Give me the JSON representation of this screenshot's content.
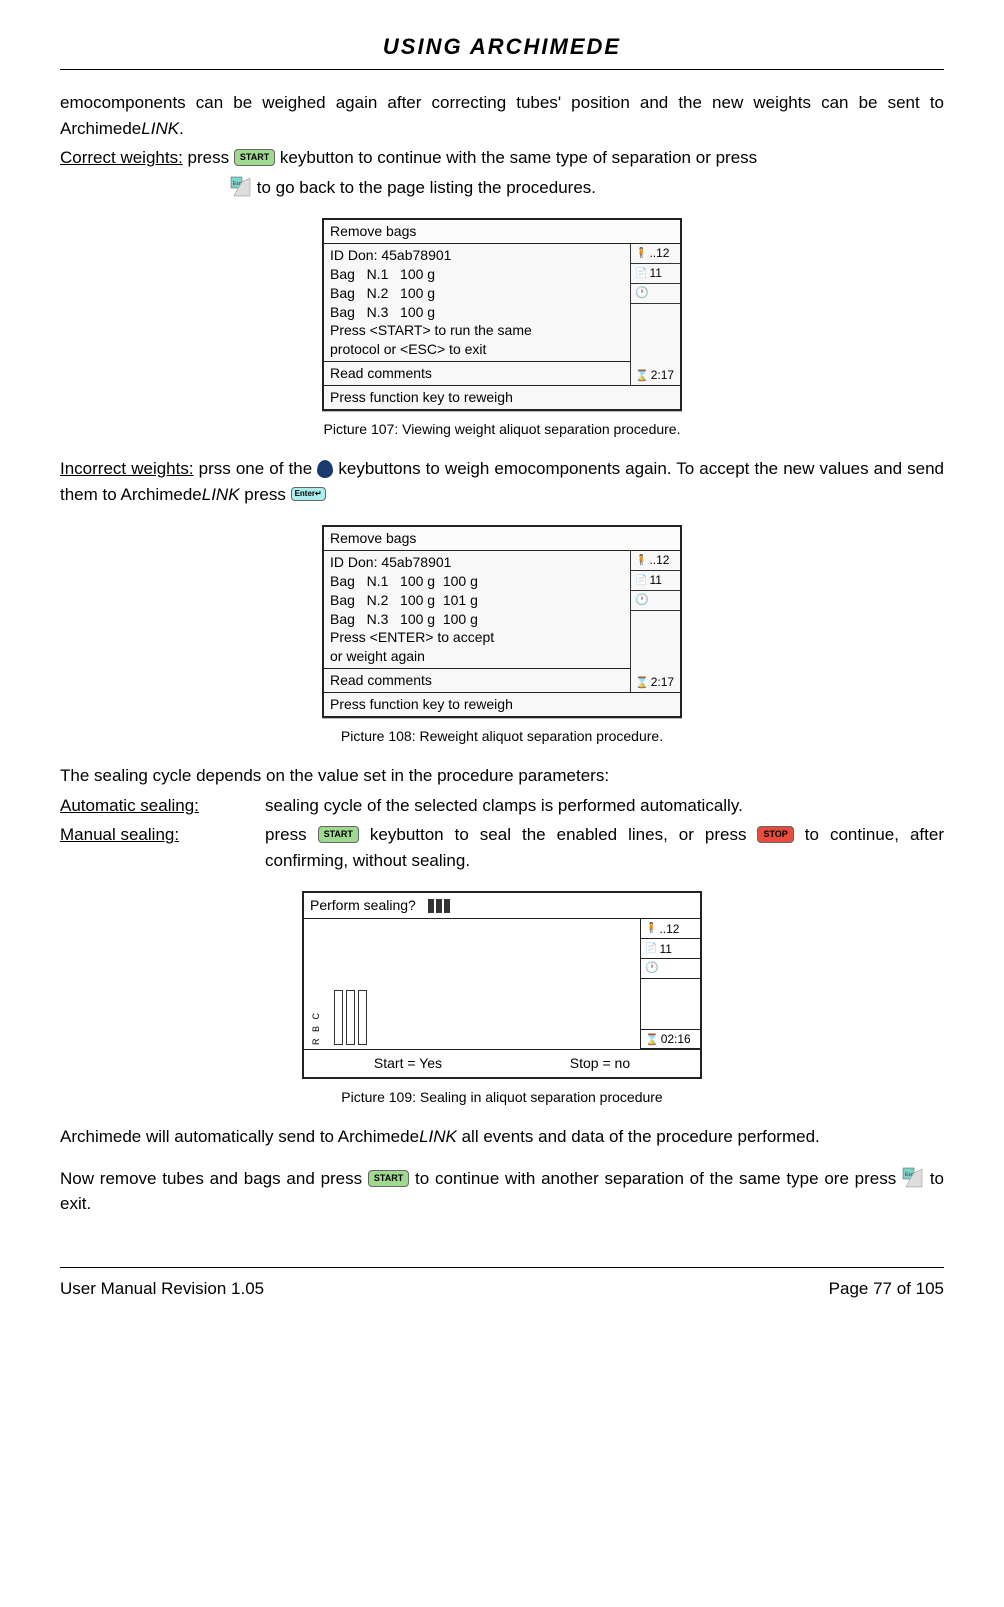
{
  "header": {
    "title": "USING ARCHIMEDE"
  },
  "intro": {
    "line1_a": "emocomponents can be weighed again after correcting tubes' position and the new weights can be sent to Archimede",
    "line1_b": "LINK",
    "line1_c": "."
  },
  "correct": {
    "label": "Correct weights:",
    "text1": "  press ",
    "text2": " keybutton to continue with the same type of separation or press ",
    "text3": " to go back to the page listing the procedures."
  },
  "screen107": {
    "title": "Remove bags",
    "id": "ID Don: 45ab78901",
    "bags": [
      "Bag   N.1   100 g",
      "Bag   N.2   100 g",
      "Bag   N.3   100 g"
    ],
    "instr1": "Press <START> to run the same",
    "instr2": "protocol or  <ESC> to exit",
    "read": "Read comments",
    "footer": "Press function key to reweigh",
    "side1": "..12",
    "side2": "11",
    "time": "2:17",
    "caption": "Picture 107: Viewing weight aliquot separation procedure."
  },
  "incorrect": {
    "label": "Incorrect weights:",
    "text1": "   prss one of the ",
    "text2": " keybuttons to weigh emocomponents again. To accept the new values and send them to Archimede",
    "text2_link": "LINK",
    "text3": " press "
  },
  "screen108": {
    "title": "Remove bags",
    "id": "ID Don: 45ab78901",
    "rows": [
      "Bag   N.1   100 g  100 g",
      "Bag   N.2   100 g  101 g",
      "Bag   N.3   100 g  100 g"
    ],
    "instr1": "Press <ENTER> to accept",
    "instr2": "or weight again",
    "read": "Read comments",
    "footer": "Press function key to reweigh",
    "side1": "..12",
    "side2": "11",
    "time": "2:17",
    "caption": "Picture 108: Reweight aliquot separation procedure."
  },
  "sealing_intro": "The sealing cycle depends on the value set in the procedure parameters:",
  "auto": {
    "label": "Automatic sealing:",
    "desc": "sealing cycle of the selected clamps is performed automatically."
  },
  "manual": {
    "label": "Manual sealing:",
    "text1": "press ",
    "text2": " keybutton to seal the enabled lines, or press ",
    "text3": " to continue, after confirming, without sealing."
  },
  "screen109": {
    "title": "Perform sealing?",
    "label_rbc": "R B C",
    "side1": "..12",
    "side2": "11",
    "time": "02:16",
    "start": "Start = Yes",
    "stop": "Stop = no",
    "caption": "Picture 109: Sealing in aliquot separation procedure"
  },
  "closing": {
    "text1_a": "Archimede will automatically send to Archimede",
    "text1_b": "LINK",
    "text1_c": " all events and data of the procedure performed.",
    "text2_a": "Now remove tubes and bags and press ",
    "text2_b": " to continue with another separation of the same type ore press ",
    "text2_c": " to exit."
  },
  "footer": {
    "left": "User Manual Revision 1.05",
    "right": "Page 77 of 105"
  },
  "buttons": {
    "start": "START",
    "stop": "STOP",
    "enter": "Enter↵",
    "esc": "Esc"
  }
}
